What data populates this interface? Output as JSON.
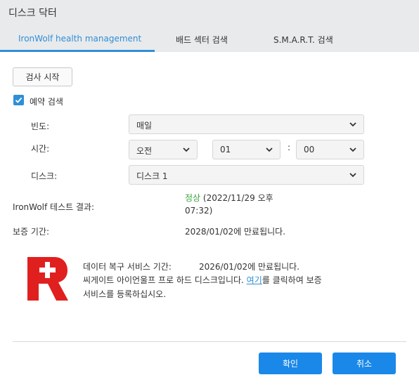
{
  "window": {
    "title": "디스크 닥터"
  },
  "tabs": [
    {
      "label": "IronWolf health management"
    },
    {
      "label": "배드 섹터 검색"
    },
    {
      "label": "S.M.A.R.T. 검색"
    }
  ],
  "start_button": {
    "label": "검사 시작"
  },
  "schedule_checkbox": {
    "label": "예약 검색",
    "checked": true
  },
  "frequency": {
    "label": "빈도:",
    "value": "매일"
  },
  "time": {
    "label": "시간:",
    "ampm": "오전",
    "hour": "01",
    "separator": ":",
    "minute": "00"
  },
  "disk": {
    "label": "디스크:",
    "value": "디스크 1"
  },
  "ironwolf_result": {
    "label": "IronWolf 테스트 결과:",
    "status": "정상",
    "timestamp_line1": " (2022/11/29 오후",
    "timestamp_line2": "07:32)"
  },
  "warranty": {
    "label": "보증 기간:",
    "value": "2028/01/02에 만료됩니다."
  },
  "rescue": {
    "line1_label": "데이터 복구 서비스 기간:",
    "line1_value": "2026/01/02에 만료됩니다.",
    "line2_prefix": "씨게이트 아이언울프 프로 하드 디스크입니다. ",
    "line2_link": "여기",
    "line2_suffix": "를 클릭하여 보증",
    "line3": "서비스를 등록하십시오.",
    "logo_color": "#e0201f"
  },
  "footer": {
    "ok_label": "확인",
    "cancel_label": "취소"
  },
  "colors": {
    "accent": "#2f8fd6",
    "button_primary": "#1a88e8",
    "status_ok": "#3aa33a"
  }
}
